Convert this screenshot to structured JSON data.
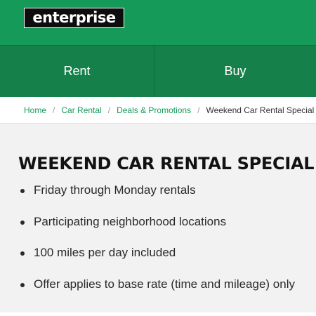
{
  "header": {
    "logo_text": "enterprise",
    "brand_color": "#169a5a",
    "nav_color": "#16804b"
  },
  "nav": {
    "items": [
      {
        "label": "Rent"
      },
      {
        "label": "Buy"
      }
    ]
  },
  "breadcrumb": {
    "links": [
      {
        "label": "Home"
      },
      {
        "label": "Car Rental"
      },
      {
        "label": "Deals & Promotions"
      }
    ],
    "separator": "/",
    "current": "Weekend Car Rental Special"
  },
  "main": {
    "title": "WEEKEND CAR RENTAL SPECIAL",
    "bullets": [
      "Friday through Monday rentals",
      "Participating neighborhood locations",
      "100 miles per day included",
      "Offer applies to base rate (time and mileage) only"
    ]
  }
}
